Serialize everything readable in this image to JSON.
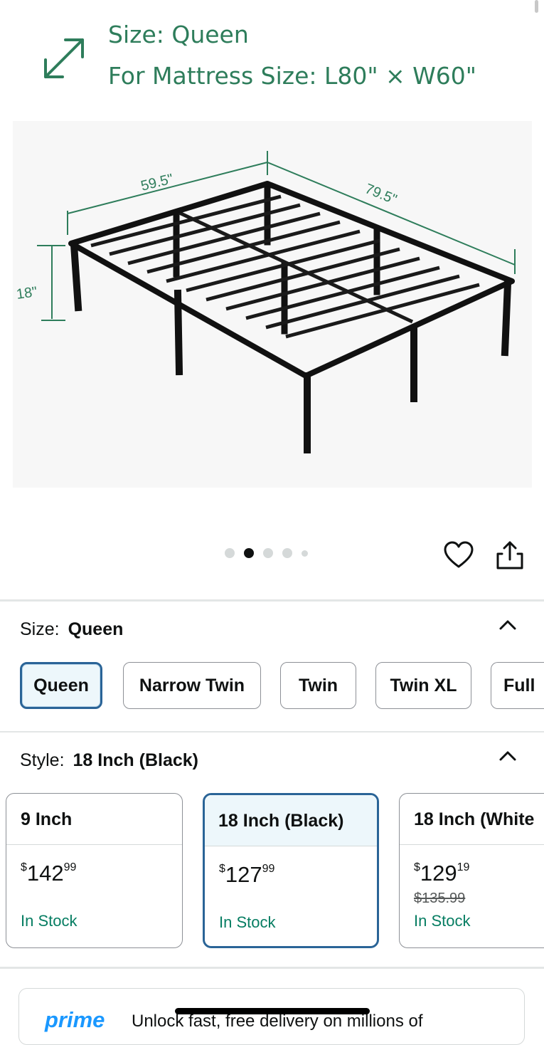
{
  "gallery": {
    "caption_line1": "Size: Queen",
    "caption_line2": "For Mattress Size: L80\" × W60\"",
    "dim_width": "59.5\"",
    "dim_length": "79.5\"",
    "dim_height": "18\"",
    "image_count": 5,
    "active_index": 1,
    "icons": {
      "resize": "diagonal-arrows-icon",
      "favorite": "heart-icon",
      "share": "share-icon"
    },
    "accent_color": "#2e7d5b"
  },
  "size": {
    "label": "Size:",
    "value": "Queen",
    "options": [
      "Queen",
      "Narrow Twin",
      "Twin",
      "Twin XL",
      "Full"
    ],
    "selected": "Queen"
  },
  "style": {
    "label": "Style:",
    "value": "18 Inch (Black)",
    "cards": [
      {
        "name": "9 Inch",
        "price_symbol": "$",
        "price_whole": "142",
        "price_cents": "99",
        "was_price": "",
        "stock": "In Stock"
      },
      {
        "name": "18 Inch (Black)",
        "price_symbol": "$",
        "price_whole": "127",
        "price_cents": "99",
        "was_price": "",
        "stock": "In Stock"
      },
      {
        "name": "18 Inch (White",
        "price_symbol": "$",
        "price_whole": "129",
        "price_cents": "19",
        "was_price": "$135.99",
        "stock": "In Stock"
      }
    ]
  },
  "prime": {
    "logo": "prime",
    "text": "Unlock fast, free delivery on millions of"
  },
  "colors": {
    "selected_border": "#2a6497",
    "selected_fill": "#edf7fb",
    "in_stock": "#067d62",
    "prime_blue": "#1a98ff"
  }
}
